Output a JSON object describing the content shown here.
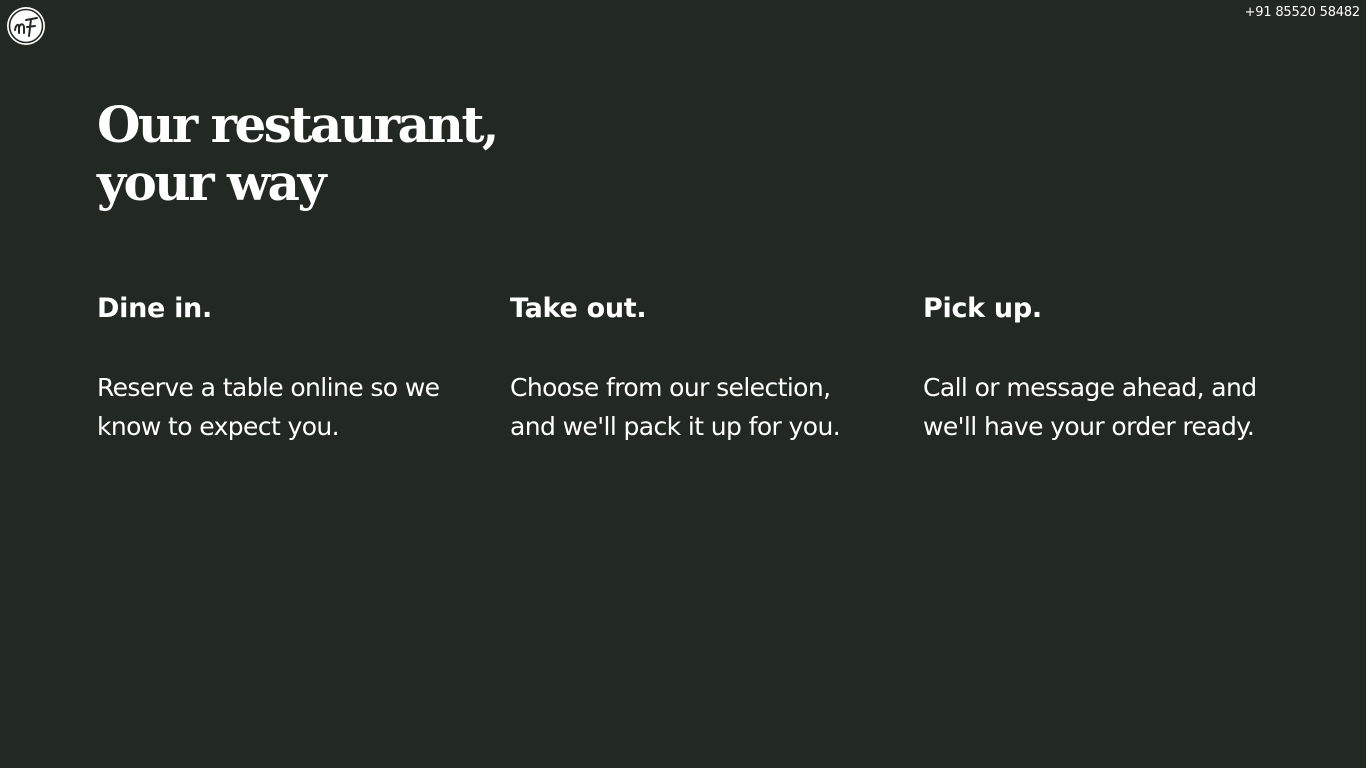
{
  "header": {
    "logo_name": "restaurant-logo",
    "phone": "+91 85520 58482"
  },
  "hero": {
    "headline_line1": "Our restaurant,",
    "headline_line2": "your way"
  },
  "options": [
    {
      "title": "Dine in.",
      "description": "Reserve a table online so we know to expect you."
    },
    {
      "title": "Take out.",
      "description": "Choose from our selection, and we'll pack it up for you."
    },
    {
      "title": "Pick up.",
      "description": "Call or message ahead, and we'll have your order ready."
    }
  ],
  "colors": {
    "background": "#212922",
    "text": "#ffffff"
  }
}
